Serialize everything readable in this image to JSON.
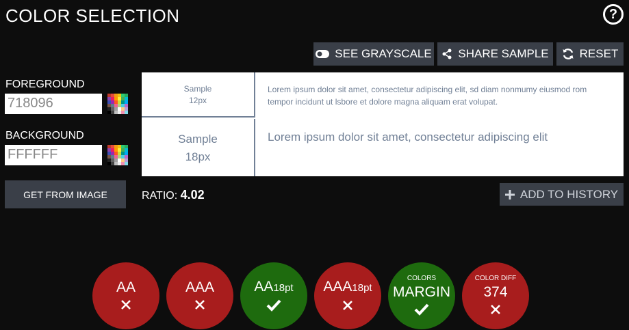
{
  "header": {
    "title": "COLOR SELECTION",
    "help_icon": "?"
  },
  "toolbar": {
    "grayscale_label": "SEE GRAYSCALE",
    "share_label": "SHARE SAMPLE",
    "reset_label": "RESET"
  },
  "foreground": {
    "label": "FOREGROUND",
    "value": "718096"
  },
  "background": {
    "label": "BACKGROUND",
    "value": "FFFFFF"
  },
  "get_from_image_label": "GET FROM IMAGE",
  "sample": {
    "small_label_1": "Sample",
    "small_label_2": "12px",
    "large_label_1": "Sample",
    "large_label_2": "18px",
    "small_text": "Lorem ipsum dolor sit amet, consectetur adipiscing elit, sd diam nonmumy eiusmod rom tempor incidunt ut lsbore et dolore magna aliquam erat volupat.",
    "large_text": "Lorem ipsum dolor sit amet, consectetur adipiscing elit",
    "text_color": "#718096"
  },
  "ratio": {
    "label": "RATIO:",
    "value": "4.02"
  },
  "add_history_label": "ADD TO HISTORY",
  "results": [
    {
      "top": "",
      "main": "AA",
      "sub": "",
      "status": "fail"
    },
    {
      "top": "",
      "main": "AAA",
      "sub": "",
      "status": "fail"
    },
    {
      "top": "",
      "main": "AA",
      "sub": "18pt",
      "status": "pass"
    },
    {
      "top": "",
      "main": "AAA",
      "sub": "18pt",
      "status": "fail"
    },
    {
      "top": "COLORS",
      "main": "MARGIN",
      "sub": "",
      "status": "pass"
    },
    {
      "top": "COLOR DIFF",
      "main": "374",
      "sub": "",
      "status": "fail"
    }
  ],
  "colors": {
    "fail": "#a81d1d",
    "pass": "#1e6b0e",
    "button": "#3a3f48"
  }
}
